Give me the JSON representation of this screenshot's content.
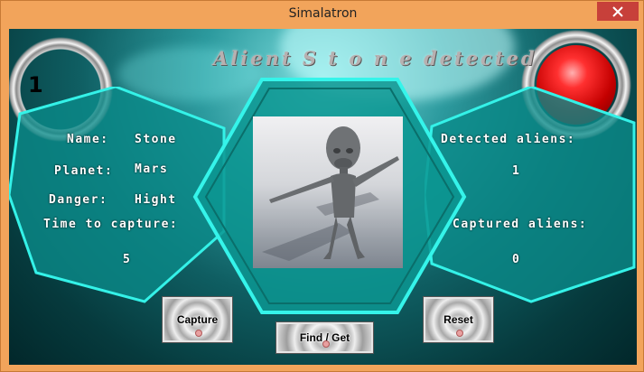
{
  "window": {
    "title": "Simalatron"
  },
  "banner": {
    "text": "Alient S t o n e detected"
  },
  "level": {
    "value": "1"
  },
  "alien_info": {
    "name_label": "Name:",
    "name_value": "Stone",
    "planet_label": "Planet:",
    "planet_value": "Mars",
    "danger_label": "Danger:",
    "danger_value": "Hight",
    "time_label": "Time to capture:",
    "time_value": "5"
  },
  "stats": {
    "detected_label": "Detected aliens:",
    "detected_value": "1",
    "captured_label": "Captured aliens:",
    "captured_value": "0"
  },
  "buttons": {
    "capture": "Capture",
    "find_get": "Find / Get",
    "reset": "Reset"
  },
  "colors": {
    "title_bar": "#f2a45b",
    "close_button": "#c7403a",
    "panel_fill": "#0e8c8a",
    "panel_border": "#2ef0e6",
    "alarm_light": "#d81818"
  },
  "icons": {
    "close": "close-icon",
    "alarm": "alarm-light-icon",
    "level_ring": "level-ring-icon"
  }
}
